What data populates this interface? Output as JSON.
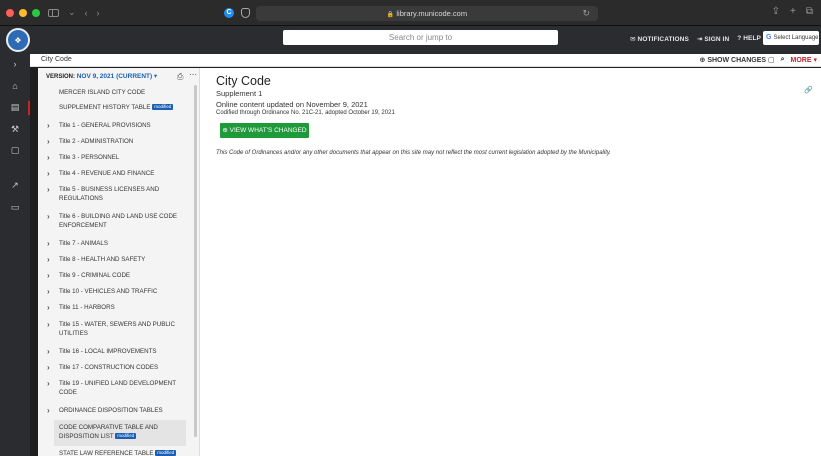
{
  "browser": {
    "url": "library.municode.com"
  },
  "header": {
    "search_placeholder": "Search or jump to",
    "notifications": "NOTIFICATIONS",
    "sign_in": "SIGN IN",
    "help": "HELP",
    "select_language": "Select Language"
  },
  "breadcrumb": {
    "label": "City Code",
    "show_changes": "SHOW CHANGES",
    "more": "MORE"
  },
  "toc": {
    "version_label": "VERSION:",
    "version_value": "NOV 9, 2021 (CURRENT)",
    "badge_label": "modified",
    "items": [
      {
        "chevron": false,
        "text": "MERCER ISLAND CITY CODE"
      },
      {
        "chevron": false,
        "text": "SUPPLEMENT HISTORY TABLE",
        "badge": true
      },
      {
        "chevron": true,
        "text": "Title 1 - GENERAL PROVISIONS"
      },
      {
        "chevron": true,
        "text": "Title 2 - ADMINISTRATION"
      },
      {
        "chevron": true,
        "text": "Title 3 - PERSONNEL"
      },
      {
        "chevron": true,
        "text": "Title 4 - REVENUE AND FINANCE"
      },
      {
        "chevron": true,
        "text": "Title 5 - BUSINESS LICENSES AND REGULATIONS"
      },
      {
        "chevron": true,
        "text": "Title 6 - BUILDING AND LAND USE CODE ENFORCEMENT"
      },
      {
        "chevron": true,
        "text": "Title 7 - ANIMALS"
      },
      {
        "chevron": true,
        "text": "Title 8 - HEALTH AND SAFETY"
      },
      {
        "chevron": true,
        "text": "Title 9 - CRIMINAL CODE"
      },
      {
        "chevron": true,
        "text": "Title 10 - VEHICLES AND TRAFFIC"
      },
      {
        "chevron": true,
        "text": "Title 11 - HARBORS"
      },
      {
        "chevron": true,
        "text": "Title 15 - WATER, SEWERS AND PUBLIC UTILITIES"
      },
      {
        "chevron": true,
        "text": "Title 16 - LOCAL IMPROVEMENTS"
      },
      {
        "chevron": true,
        "text": "Title 17 - CONSTRUCTION CODES"
      },
      {
        "chevron": true,
        "text": "Title 19 - UNIFIED LAND DEVELOPMENT CODE"
      },
      {
        "chevron": true,
        "text": "ORDINANCE DISPOSITION TABLES"
      },
      {
        "chevron": false,
        "text": "CODE COMPARATIVE TABLE AND DISPOSITION LIST",
        "badge": true
      },
      {
        "chevron": false,
        "text": "STATE LAW REFERENCE TABLE",
        "badge": true
      }
    ]
  },
  "main": {
    "title": "City Code",
    "supplement": "Supplement 1",
    "updated": "Online content updated on November 9, 2021",
    "codified": "Codified through Ordinance No. 21C-21, adopted October 19, 2021",
    "view_changes": "VIEW WHAT'S CHANGED",
    "disclaimer": "This Code of Ordinances and/or any other documents that appear on this site may not reflect the most current legislation adopted by the Municipality."
  },
  "colors": {
    "accent_blue": "#1a5fb4",
    "button_green": "#1e9a3b",
    "more_red": "#c1272d",
    "header_dark": "#2a2c30"
  }
}
